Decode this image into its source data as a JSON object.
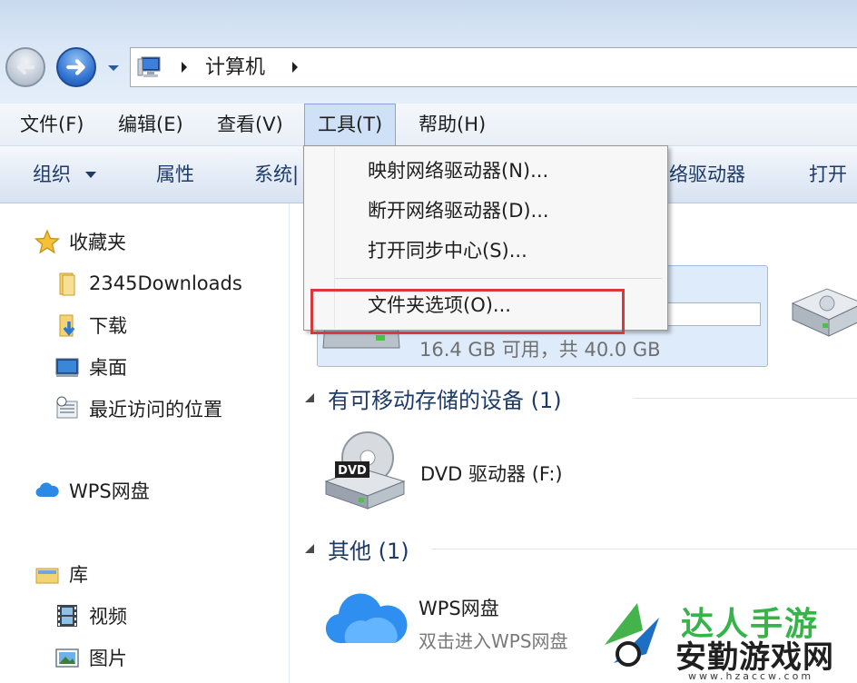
{
  "address_bar": {
    "breadcrumb": [
      "计算机"
    ]
  },
  "menu_bar": {
    "items": [
      "文件(F)",
      "编辑(E)",
      "查看(V)",
      "工具(T)",
      "帮助(H)"
    ],
    "active": "工具(T)"
  },
  "command_bar": {
    "organize": "组织",
    "properties": "属性",
    "system": "系统|",
    "map_drive_partial": "络驱动器",
    "open_partial": "打开"
  },
  "tools_menu": {
    "items": [
      "映射网络驱动器(N)...",
      "断开网络驱动器(D)...",
      "打开同步中心(S)...",
      "文件夹选项(O)..."
    ],
    "highlighted": "文件夹选项(O)..."
  },
  "nav_pane": {
    "favorites": {
      "label": "收藏夹",
      "items": [
        "2345Downloads",
        "下载",
        "桌面",
        "最近访问的位置"
      ]
    },
    "wps": "WPS网盘",
    "libraries": {
      "label": "库",
      "items": [
        "视频",
        "图片"
      ]
    }
  },
  "content": {
    "drive_c": {
      "space_text": "16.4 GB 可用，共 40.0 GB",
      "used_fraction": 0.59
    },
    "removable_group": "有可移动存储的设备 (1)",
    "dvd_drive": "DVD 驱动器 (F:)",
    "dvd_badge": "DVD",
    "other_group": "其他 (1)",
    "wps_item": {
      "name": "WPS网盘",
      "desc": "双击进入WPS网盘"
    }
  },
  "watermark": {
    "top": "达人手游",
    "main": "安勤游戏网",
    "url": "www.hzaccw.com"
  },
  "colors": {
    "highlight_box": "#d9393a",
    "accent": "#1e3a66",
    "watermark_green": "#36b44a"
  }
}
